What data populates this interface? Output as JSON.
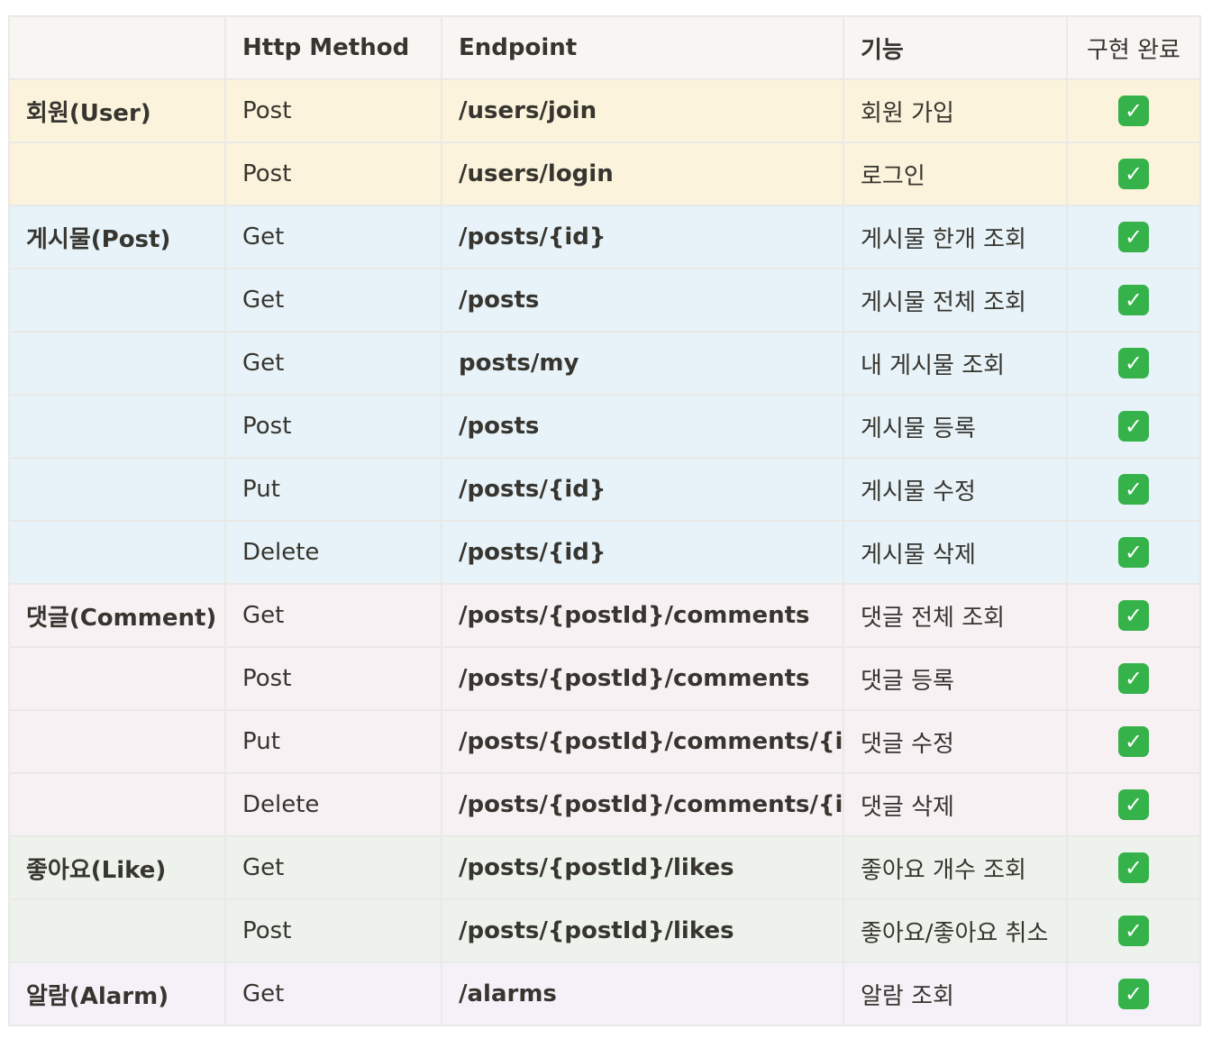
{
  "headers": [
    "",
    "Http Method",
    "Endpoint",
    "기능",
    "구현 완료"
  ],
  "done_icon": "check-mark-button-icon",
  "done_symbol": "✓",
  "done_color": "#35b24a",
  "rows": [
    {
      "group": "회원(User)",
      "method": "Post",
      "endpoint": "/users/join",
      "feature": "회원 가입",
      "bg": "#fbf3db"
    },
    {
      "group": "",
      "method": "Post",
      "endpoint": "/users/login",
      "feature": "로그인",
      "bg": "#fbf3db"
    },
    {
      "group": "게시물(Post)",
      "method": "Get",
      "endpoint": "/posts/{id}",
      "feature": "게시물 한개 조회",
      "bg": "#e7f3f8"
    },
    {
      "group": "",
      "method": "Get",
      "endpoint": "/posts",
      "feature": "게시물 전체 조회",
      "bg": "#e7f3f8"
    },
    {
      "group": "",
      "method": "Get",
      "endpoint": "posts/my",
      "feature": "내 게시물 조회",
      "bg": "#e7f3f8"
    },
    {
      "group": "",
      "method": "Post",
      "endpoint": "/posts",
      "feature": "게시물 등록",
      "bg": "#e7f3f8"
    },
    {
      "group": "",
      "method": "Put",
      "endpoint": "/posts/{id}",
      "feature": "게시물 수정",
      "bg": "#e7f3f8"
    },
    {
      "group": "",
      "method": "Delete",
      "endpoint": "/posts/{id}",
      "feature": "게시물 삭제",
      "bg": "#e7f3f8"
    },
    {
      "group": "댓글(Comment)",
      "method": "Get",
      "endpoint": "/posts/{postId}/comments",
      "feature": "댓글 전체 조회",
      "bg": "#f8f1f3"
    },
    {
      "group": "",
      "method": "Post",
      "endpoint": "/posts/{postId}/comments",
      "feature": "댓글 등록",
      "bg": "#f8f1f3"
    },
    {
      "group": "",
      "method": "Put",
      "endpoint": "/posts/{postId}/comments/{id}",
      "feature": "댓글 수정",
      "bg": "#f8f1f3"
    },
    {
      "group": "",
      "method": "Delete",
      "endpoint": "/posts/{postId}/comments/{id}",
      "feature": "댓글 삭제",
      "bg": "#f8f1f3"
    },
    {
      "group": "좋아요(Like)",
      "method": "Get",
      "endpoint": "/posts/{postId}/likes",
      "feature": "좋아요 개수 조회",
      "bg": "#edf3ec"
    },
    {
      "group": "",
      "method": "Post",
      "endpoint": "/posts/{postId}/likes",
      "feature": "좋아요/좋아요 취소",
      "bg": "#edf3ec"
    },
    {
      "group": "알람(Alarm)",
      "method": "Get",
      "endpoint": "/alarms",
      "feature": "알람 조회",
      "bg": "#f4f2f8"
    }
  ]
}
